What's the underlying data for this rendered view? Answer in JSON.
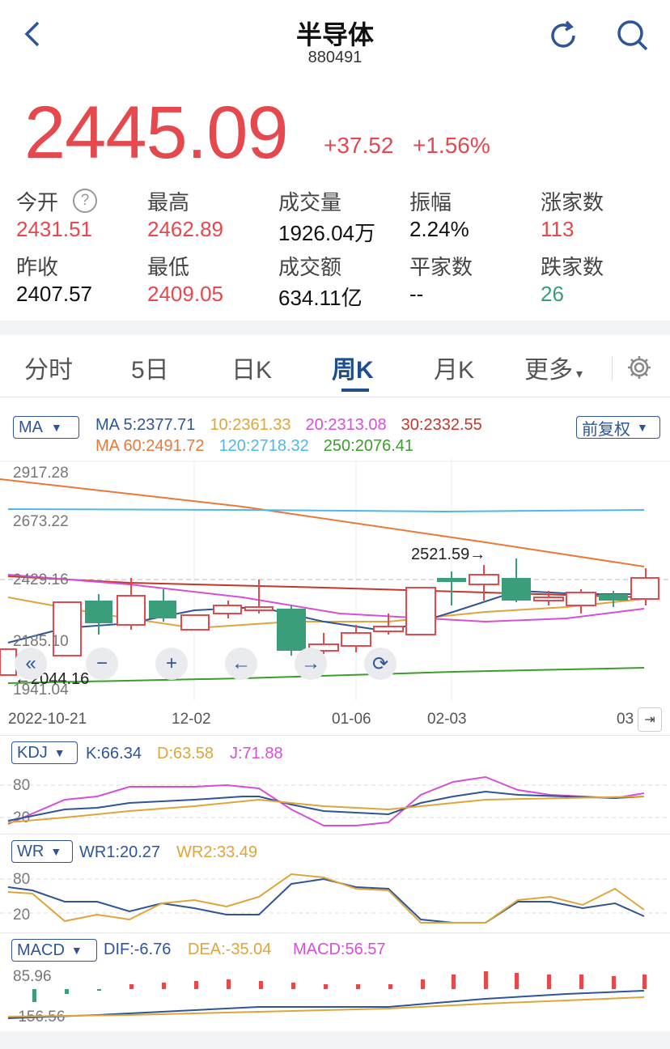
{
  "header": {
    "title": "半导体",
    "code": "880491"
  },
  "quote": {
    "price": "2445.09",
    "change": "+37.52",
    "change_pct": "+1.56%"
  },
  "stats": [
    {
      "label": "今开",
      "value": "2431.51",
      "color": "red"
    },
    {
      "label": "最高",
      "value": "2462.89",
      "color": "red"
    },
    {
      "label": "成交量",
      "value": "1926.04万",
      "color": "blk"
    },
    {
      "label": "振幅",
      "value": "2.24%",
      "color": "blk"
    },
    {
      "label": "涨家数",
      "value": "113",
      "color": "red"
    },
    {
      "label": "昨收",
      "value": "2407.57",
      "color": "blk"
    },
    {
      "label": "最低",
      "value": "2409.05",
      "color": "red"
    },
    {
      "label": "成交额",
      "value": "634.11亿",
      "color": "blk"
    },
    {
      "label": "平家数",
      "value": "--",
      "color": "blk"
    },
    {
      "label": "跌家数",
      "value": "26",
      "color": "green"
    }
  ],
  "tabs": [
    "分时",
    "5日",
    "日K",
    "周K",
    "月K",
    "更多"
  ],
  "ma": {
    "selector": "MA",
    "adjust": "前复权",
    "line1": [
      {
        "text": "MA 5:2377.71",
        "color": "#2f5597"
      },
      {
        "text": "10:2361.33",
        "color": "#e0a53a"
      },
      {
        "text": "20:2313.08",
        "color": "#d64fd6"
      },
      {
        "text": "30:2332.55",
        "color": "#c0392b"
      }
    ],
    "line2": [
      {
        "text": "MA 60:2491.72",
        "color": "#e8793a"
      },
      {
        "text": "120:2718.32",
        "color": "#4fb8e6"
      },
      {
        "text": "250:2076.41",
        "color": "#3a9e2a"
      }
    ]
  },
  "price_axis": [
    "2917.28",
    "2673.22",
    "2429.16",
    "2185.10",
    "1941.04"
  ],
  "annotations": {
    "high": "2521.59→",
    "low": "←2044.16"
  },
  "dates": [
    "2022-10-21",
    "12-02",
    "01-06",
    "02-03",
    "03"
  ],
  "kdj": {
    "selector": "KDJ",
    "k": "K:66.34",
    "d": "D:63.58",
    "j": "J:71.88",
    "axis": [
      "80",
      "20"
    ]
  },
  "wr": {
    "selector": "WR",
    "wr1": "WR1:20.27",
    "wr2": "WR2:33.49",
    "axis": [
      "80",
      "20"
    ]
  },
  "macd": {
    "selector": "MACD",
    "dif": "DIF:-6.76",
    "dea": "DEA:-35.04",
    "macd": "MACD:56.57",
    "axis": [
      "85.96",
      "-156.56"
    ]
  },
  "colors": {
    "up": "#e5484d",
    "down": "#3a9e7a",
    "accent": "#1f4e8c"
  }
}
